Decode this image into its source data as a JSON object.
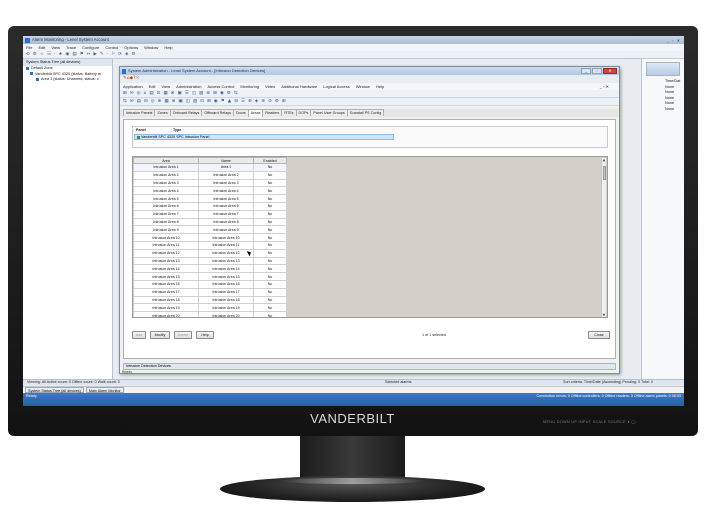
{
  "app": {
    "title": "Alarm Monitoring - Lenel System Account",
    "window_controls": "_ ▫ ✕",
    "menus": [
      "File",
      "Edit",
      "View",
      "Trace",
      "Configure",
      "Control",
      "Options",
      "Window",
      "Help"
    ],
    "toolbar_glyphs": [
      "⟲",
      "⚙",
      "☆",
      "☷",
      "·",
      "★",
      "◉",
      "▤",
      "⚑",
      "↔",
      "▶",
      "✎",
      "·",
      "⚐",
      "⟳",
      "◈",
      "⚙"
    ]
  },
  "tree": {
    "header": "System Status Tree (all devices)",
    "items": [
      {
        "label": "Default Zone",
        "level": 0
      },
      {
        "label": "Vanderbilt SPC 4320 (status: Battery m",
        "level": 1
      },
      {
        "label": "Area 1 (status: Unarmed, status: c",
        "level": 2
      }
    ]
  },
  "right_panel": {
    "header": "Time/Dat",
    "values": [
      "None",
      "None",
      "None",
      "None",
      "None"
    ]
  },
  "dialog": {
    "title": "System Administration - Lenel System Account - [Intrusion Detection Devices]",
    "menus": [
      "Application",
      "Edit",
      "View",
      "Administration",
      "Access Control",
      "Monitoring",
      "Video",
      "Additional Hardware",
      "Logical Access",
      "Window",
      "Help"
    ],
    "mdi_controls": "_ ▫ ✕",
    "tool0_glyphs": [
      "✎",
      "⌂",
      "◆",
      "?",
      "☉"
    ],
    "tool1_glyphs": [
      "⊞",
      "✉",
      "◎",
      "⌂",
      "▤",
      "⊡",
      "▦",
      "⊗",
      "▣",
      "☰",
      "◫",
      "▧",
      "⊕",
      "⊞",
      "◉",
      "⚙",
      "⇆"
    ],
    "tool2_glyphs": [
      "⇆",
      "✉",
      "▤",
      "⊟",
      "◎",
      "⊕",
      "▦",
      "⊗",
      "▣",
      "◫",
      "▨",
      "⊡",
      "⊞",
      "◉",
      "⚑",
      "▲",
      "⊟",
      "☰",
      "⊕",
      "◈",
      "⊛",
      "⊘",
      "⚙",
      "⊞"
    ],
    "tabs": [
      "Intrusion Panels",
      "Zones",
      "Onboard Relays",
      "Offboard Relays",
      "Doors",
      "Areas",
      "Readers",
      "RTEs",
      "DGPs",
      "Panel User Groups",
      "Guardall PS Config"
    ],
    "active_tab": "Areas",
    "panel_table": {
      "headers": [
        "Panel",
        "Type"
      ],
      "row": "Vanderbilt SPC 4320  SPC Intrusion Panel"
    },
    "grid": {
      "headers": [
        "Area",
        "Name",
        "Enabled"
      ],
      "rows": [
        {
          "area": "Intrusion Area 1",
          "name": "Area 1",
          "enabled": "No"
        },
        {
          "area": "Intrusion Area 2",
          "name": "Intrusion Area 2",
          "enabled": "No"
        },
        {
          "area": "Intrusion Area 3",
          "name": "Intrusion Area 3",
          "enabled": "No"
        },
        {
          "area": "Intrusion Area 4",
          "name": "Intrusion Area 4",
          "enabled": "No"
        },
        {
          "area": "Intrusion Area 5",
          "name": "Intrusion Area 5",
          "enabled": "No"
        },
        {
          "area": "Intrusion Area 6",
          "name": "Intrusion Area 6",
          "enabled": "No"
        },
        {
          "area": "Intrusion Area 7",
          "name": "Intrusion Area 7",
          "enabled": "No"
        },
        {
          "area": "Intrusion Area 8",
          "name": "Intrusion Area 8",
          "enabled": "No"
        },
        {
          "area": "Intrusion Area 9",
          "name": "Intrusion Area 9",
          "enabled": "No"
        },
        {
          "area": "Intrusion Area 10",
          "name": "Intrusion Area 10",
          "enabled": "No"
        },
        {
          "area": "Intrusion Area 11",
          "name": "Intrusion Area 11",
          "enabled": "No"
        },
        {
          "area": "Intrusion Area 12",
          "name": "Intrusion Area 12",
          "enabled": "No"
        },
        {
          "area": "Intrusion Area 13",
          "name": "Intrusion Area 13",
          "enabled": "No"
        },
        {
          "area": "Intrusion Area 14",
          "name": "Intrusion Area 14",
          "enabled": "No"
        },
        {
          "area": "Intrusion Area 15",
          "name": "Intrusion Area 15",
          "enabled": "No"
        },
        {
          "area": "Intrusion Area 16",
          "name": "Intrusion Area 16",
          "enabled": "No"
        },
        {
          "area": "Intrusion Area 17",
          "name": "Intrusion Area 17",
          "enabled": "No"
        },
        {
          "area": "Intrusion Area 18",
          "name": "Intrusion Area 18",
          "enabled": "No"
        },
        {
          "area": "Intrusion Area 19",
          "name": "Intrusion Area 19",
          "enabled": "No"
        },
        {
          "area": "Intrusion Area 20",
          "name": "Intrusion Area 20",
          "enabled": "No"
        }
      ]
    },
    "buttons": {
      "add": "Add",
      "modify": "Modify",
      "delete": "Delete",
      "help": "Help",
      "close": "Close"
    },
    "selection_count": "1 of 1 selected",
    "status_tab": "Intrusion Detection Devices",
    "ready": "Ready"
  },
  "low_strip": {
    "left": "Viewing: All  Active count: 0  Offline count: 0  Walk count: 0",
    "middle": "Selected alarms",
    "right": "Sort criteria: Time/Date (Ascending)  Pending: 0  Total: 0"
  },
  "taskbar": {
    "items": [
      "System Status Tree (all devices)",
      "Main Alarm Monitor"
    ]
  },
  "status": {
    "left": "Ready",
    "right": "Connection errors: 0  Offline controllers: 0  Offline readers: 0  Offline alarm panels: 0  08:53"
  },
  "monitor": {
    "brand": "VANDERBILT",
    "controls": "MENU  DOWN  UP  INPUT  SCALE  SOURCE  ●  ◯"
  },
  "colors": {
    "accent": "#2f6fc2",
    "status_bar": "#3a72c0",
    "selected_row": "#cfe5fa",
    "close_button": "#c9483b"
  }
}
